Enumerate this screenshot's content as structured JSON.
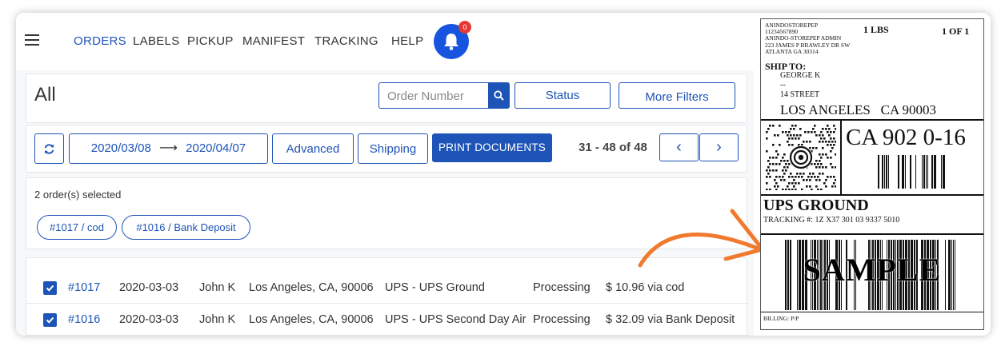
{
  "nav": {
    "items": [
      "ORDERS",
      "LABELS",
      "PICKUP",
      "MANIFEST",
      "TRACKING",
      "HELP"
    ],
    "notification_count": "0",
    "accent_color": "#1e54b7"
  },
  "header": {
    "title": "All",
    "search_placeholder": "Order Number",
    "status_label": "Status",
    "more_filters_label": "More Filters"
  },
  "toolbar": {
    "date_from": "2020/03/08",
    "date_arrow": "⟶",
    "date_to": "2020/04/07",
    "advanced_label": "Advanced",
    "shipping_label": "Shipping",
    "print_label": "PRINT DOCUMENTS",
    "pager_text": "31 - 48 of 48",
    "prev_icon": "‹",
    "next_icon": "›"
  },
  "selection": {
    "summary": "2 order(s) selected",
    "chips": [
      "#1017 / cod",
      "#1016 / Bank Deposit"
    ]
  },
  "orders": [
    {
      "id": "#1017",
      "date": "2020-03-03",
      "name": "John K",
      "address": "Los Angeles, CA, 90006",
      "service": "UPS - UPS Ground",
      "status": "Processing",
      "total": "$ 10.96 via cod"
    },
    {
      "id": "#1016",
      "date": "2020-03-03",
      "name": "John K",
      "address": "Los Angeles, CA, 90006",
      "service": "UPS - UPS Second Day Air",
      "status": "Processing",
      "total": "$ 32.09 via Bank Deposit"
    }
  ],
  "shipping_label": {
    "sender_lines": [
      "ANINDOSTOREPEP",
      "11234567890",
      "ANINDO-STOREPEP ADMIN",
      "223 JAMES P BRAWLEY DR SW",
      "ATLANTA  GA 30314"
    ],
    "weight": "1 LBS",
    "count": "1 OF 1",
    "ship_to_label": "SHIP TO:",
    "recipient_lines": [
      "GEORGE K",
      "--",
      "14 STREET"
    ],
    "city_line": "LOS ANGELES   CA 90003",
    "routing_code": "CA 902 0-16",
    "service": "UPS GROUND",
    "tracking": "TRACKING #: 1Z X37 301 03 9337 5010",
    "watermark": "SAMPLE",
    "billing": "BILLING: P/P"
  }
}
